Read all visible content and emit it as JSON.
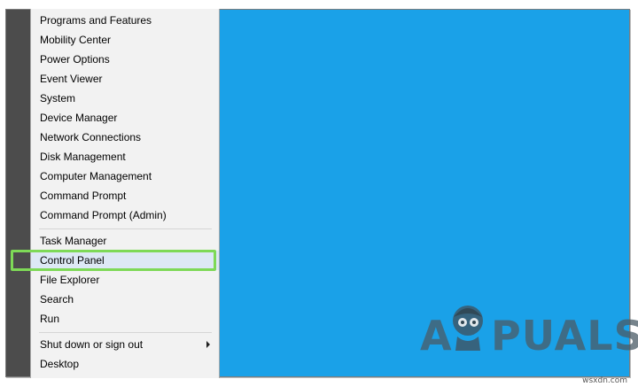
{
  "menu": {
    "group1": [
      "Programs and Features",
      "Mobility Center",
      "Power Options",
      "Event Viewer",
      "System",
      "Device Manager",
      "Network Connections",
      "Disk Management",
      "Computer Management",
      "Command Prompt",
      "Command Prompt (Admin)"
    ],
    "group2": [
      "Task Manager",
      "Control Panel",
      "File Explorer",
      "Search",
      "Run"
    ],
    "group3": [
      "Shut down or sign out",
      "Desktop"
    ],
    "highlighted": "Control Panel"
  },
  "logo": {
    "part1": "A",
    "part2": "PUALS"
  },
  "watermark": "wsxdn.com",
  "colors": {
    "desktop": "#1aa1e8",
    "menu_bg": "#f2f2f2",
    "highlight_border": "#7ed957"
  }
}
